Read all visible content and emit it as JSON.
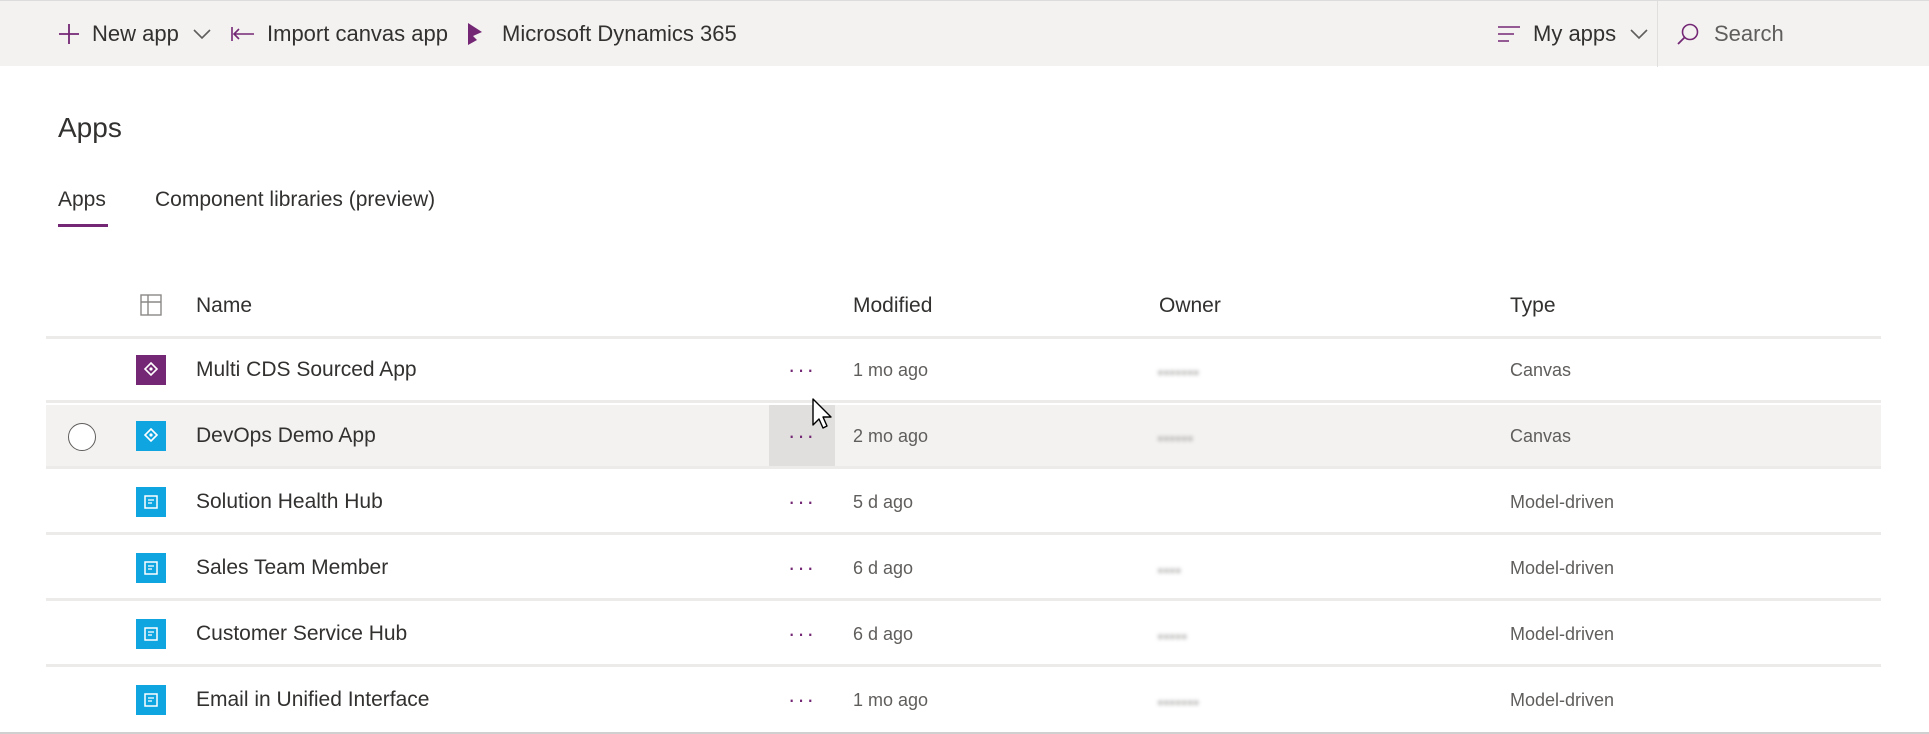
{
  "commandbar": {
    "new_app": "New app",
    "import_canvas": "Import canvas app",
    "dynamics": "Microsoft Dynamics 365",
    "filter": "My apps",
    "search_placeholder": "Search"
  },
  "page": {
    "title": "Apps",
    "tabs": [
      {
        "label": "Apps",
        "active": true
      },
      {
        "label": "Component libraries (preview)",
        "active": false
      }
    ]
  },
  "table": {
    "columns": {
      "name": "Name",
      "modified": "Modified",
      "owner": "Owner",
      "type": "Type"
    },
    "rows": [
      {
        "name": "Multi CDS Sourced App",
        "more": "···",
        "modified": "1 mo ago",
        "owner": "▪▪▪▪▪▪▪",
        "type": "Canvas",
        "icon": "canvas-app-icon",
        "icon_color": "#742774"
      },
      {
        "name": "DevOps Demo App",
        "more": "···",
        "modified": "2 mo ago",
        "owner": "▪▪▪▪▪▪",
        "type": "Canvas",
        "icon": "canvas-app-icon",
        "icon_color": "#0ea5e0"
      },
      {
        "name": "Solution Health Hub",
        "more": "···",
        "modified": "5 d ago",
        "owner": "",
        "type": "Model-driven",
        "icon": "model-driven-app-icon",
        "icon_color": "#0ea5e0"
      },
      {
        "name": "Sales Team Member",
        "more": "···",
        "modified": "6 d ago",
        "owner": "▪▪▪▪",
        "type": "Model-driven",
        "icon": "model-driven-app-icon",
        "icon_color": "#0ea5e0"
      },
      {
        "name": "Customer Service Hub",
        "more": "···",
        "modified": "6 d ago",
        "owner": "▪▪▪▪▪",
        "type": "Model-driven",
        "icon": "model-driven-app-icon",
        "icon_color": "#0ea5e0"
      },
      {
        "name": "Email in Unified Interface",
        "more": "···",
        "modified": "1 mo ago",
        "owner": "▪▪▪▪▪▪▪",
        "type": "Model-driven",
        "icon": "model-driven-app-icon",
        "icon_color": "#0ea5e0"
      }
    ]
  },
  "colors": {
    "accent": "#742774",
    "app_blue": "#0ea5e0",
    "commandbar_bg": "#f3f2f1"
  }
}
